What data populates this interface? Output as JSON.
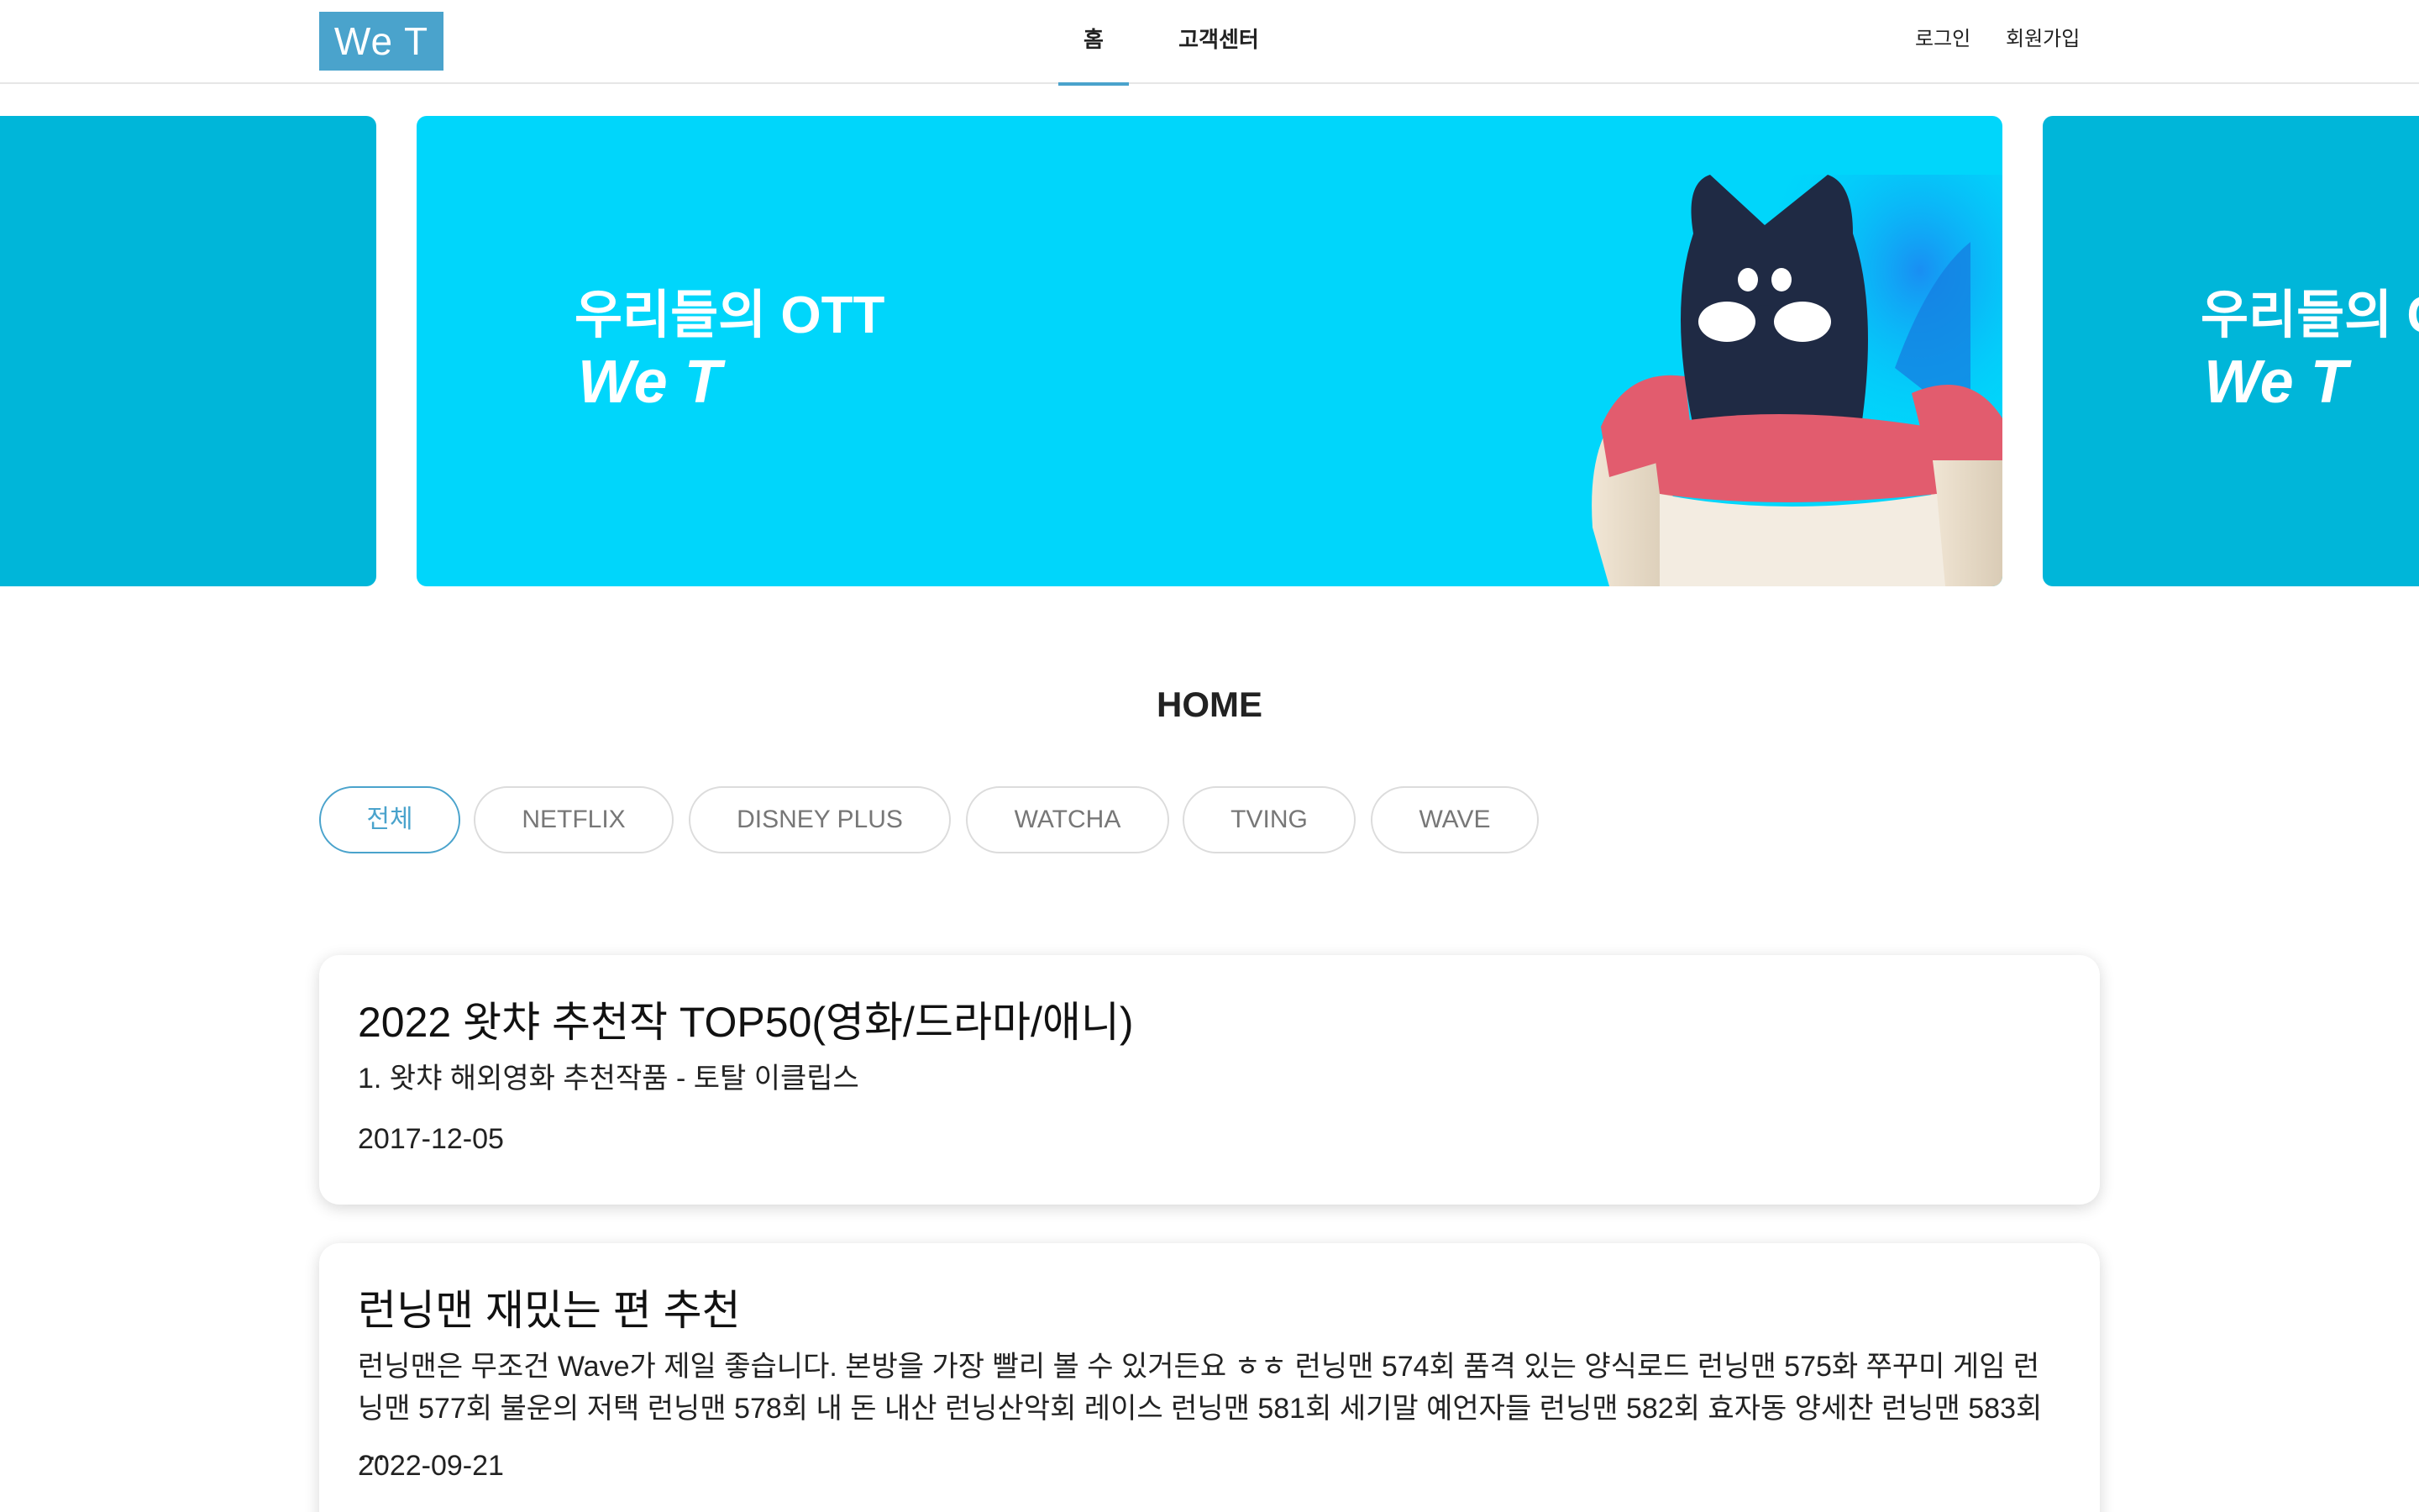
{
  "header": {
    "logo": "We T",
    "nav": [
      {
        "label": "홈",
        "active": true
      },
      {
        "label": "고객센터",
        "active": false
      }
    ],
    "login_label": "로그인",
    "signup_label": "회원가입"
  },
  "carousel": {
    "line1": "우리들의 OTT",
    "line2": "We T",
    "partial_line1": "우리들의 C",
    "slide_count": 4,
    "active_index": 0,
    "colors": {
      "main": "#00d6fb",
      "side": "#00b6d9"
    }
  },
  "section": {
    "title": "HOME"
  },
  "filters": [
    {
      "label": "전체",
      "active": true
    },
    {
      "label": "NETFLIX",
      "active": false
    },
    {
      "label": "DISNEY PLUS",
      "active": false
    },
    {
      "label": "WATCHA",
      "active": false
    },
    {
      "label": "TVING",
      "active": false
    },
    {
      "label": "WAVE",
      "active": false
    }
  ],
  "posts": [
    {
      "title": "2022 왓챠 추천작 TOP50(영화/드라마/애니)",
      "excerpt": "1. 왓챠 해외영화 추천작품 - 토탈 이클립스",
      "date": "2017-12-05"
    },
    {
      "title": "런닝맨 재밌는 편 추천",
      "excerpt": "런닝맨은 무조건 Wave가 제일 좋습니다. 본방을 가장 빨리 볼 수 있거든요 ㅎㅎ 런닝맨 574회 품격 있는 양식로드 런닝맨 575화 쭈꾸미 게임 런닝맨 577회 불운의 저택 런닝맨 578회 내 돈 내산 런닝산악회 레이스 런닝맨 581회 세기말 예언자들 런닝맨 582회 효자동 양세찬 런닝맨 583회 …",
      "date": "2022-09-21"
    }
  ],
  "colors": {
    "accent": "#4aa3cc",
    "dot_active": "#4f7cf7"
  }
}
